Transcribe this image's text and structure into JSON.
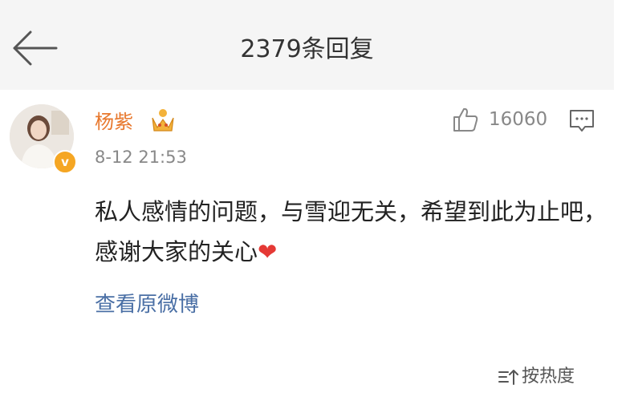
{
  "header": {
    "title": "2379条回复"
  },
  "comment": {
    "username": "杨紫",
    "time": "8-12 21:53",
    "likes": "16060",
    "content": "私人感情的问题，与雪迎无关，希望到此为止吧，感谢大家的关心",
    "heart": "❤",
    "verified_badge": "v",
    "view_original": "查看原微博"
  },
  "sort": {
    "label": "按热度"
  },
  "icons": {
    "back": "back-arrow-icon",
    "like": "thumbs-up-icon",
    "comment": "comment-icon",
    "crown": "crown-icon",
    "sort": "sort-icon"
  },
  "colors": {
    "username": "#e8782d",
    "link": "#4a6fa5",
    "heart": "#e53935",
    "badge": "#f5a623"
  }
}
